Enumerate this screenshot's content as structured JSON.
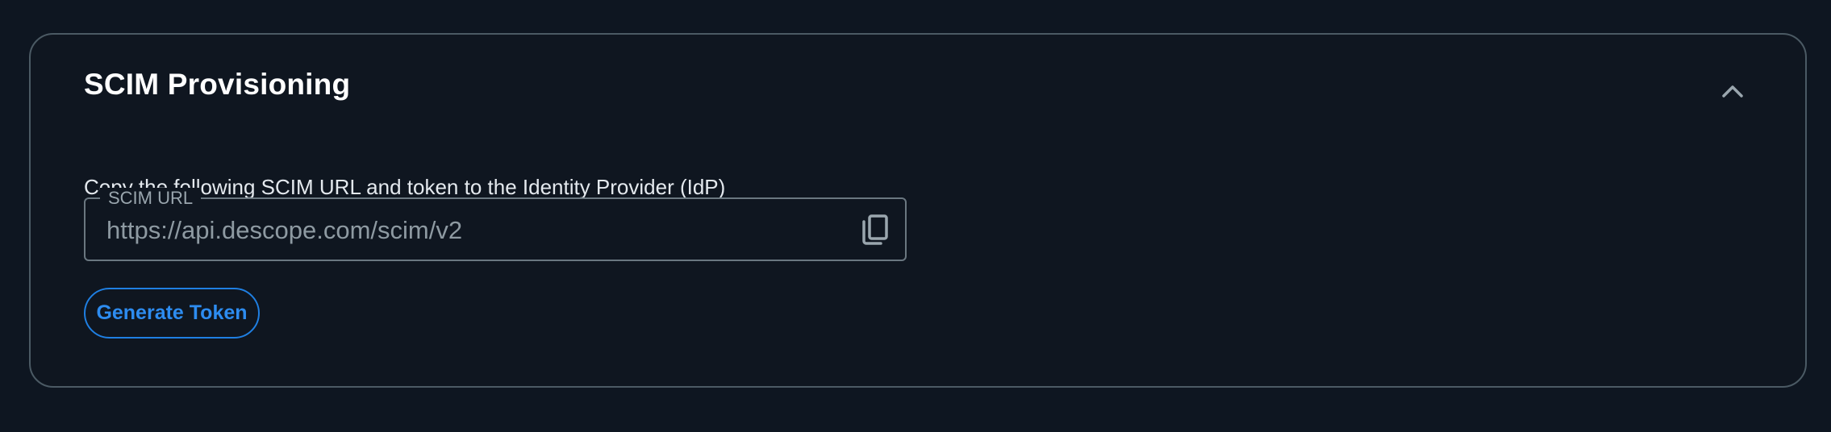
{
  "section": {
    "title": "SCIM Provisioning",
    "collapse_icon": "chevron-up-icon",
    "description": "Copy the following SCIM URL and token to the Identity Provider (IdP)"
  },
  "scim_url": {
    "label": "SCIM URL",
    "value": "https://api.descope.com/scim/v2",
    "copy_icon": "copy-icon"
  },
  "actions": {
    "generate_token_label": "Generate Token"
  },
  "colors": {
    "background": "#0e1621",
    "card_border": "#4b5a64",
    "accent": "#2d8cf0",
    "text_primary": "#ffffff",
    "text_muted": "#8e9aa2"
  }
}
